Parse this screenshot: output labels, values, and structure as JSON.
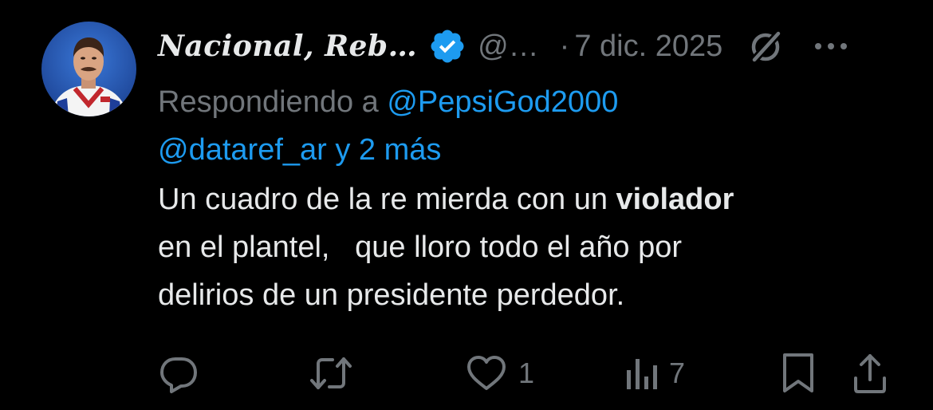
{
  "tweet": {
    "author": {
      "display_name": "Nacional, Reb…",
      "handle": "@…",
      "verified": true
    },
    "separator": "·",
    "date": "7 dic. 2025",
    "replying": {
      "prefix": "Respondiendo a",
      "mention_1": "@PepsiGod2000",
      "mention_2": "@dataref_ar",
      "suffix": "y 2 más"
    },
    "text": {
      "line1_pre": "Un cuadro de la re mierda con un ",
      "line1_bold": "violador",
      "line2": "en el plantel,   que lloro todo el año por",
      "line3": "delirios de un presidente perdedor."
    },
    "actions": {
      "reply_count": "",
      "retweet_count": "",
      "like_count": "1",
      "views_count": "7"
    }
  },
  "colors": {
    "background": "#000000",
    "primary_text": "#e7e9ea",
    "secondary_text": "#71767b",
    "link": "#1d9bf0",
    "verified_badge": "#1d9bf0"
  },
  "icons": {
    "verified": "verified-badge-icon",
    "grok": "grok-icon",
    "more": "more-icon",
    "reply": "reply-icon",
    "retweet": "retweet-icon",
    "like": "heart-icon",
    "views": "views-icon",
    "bookmark": "bookmark-icon",
    "share": "share-icon"
  }
}
